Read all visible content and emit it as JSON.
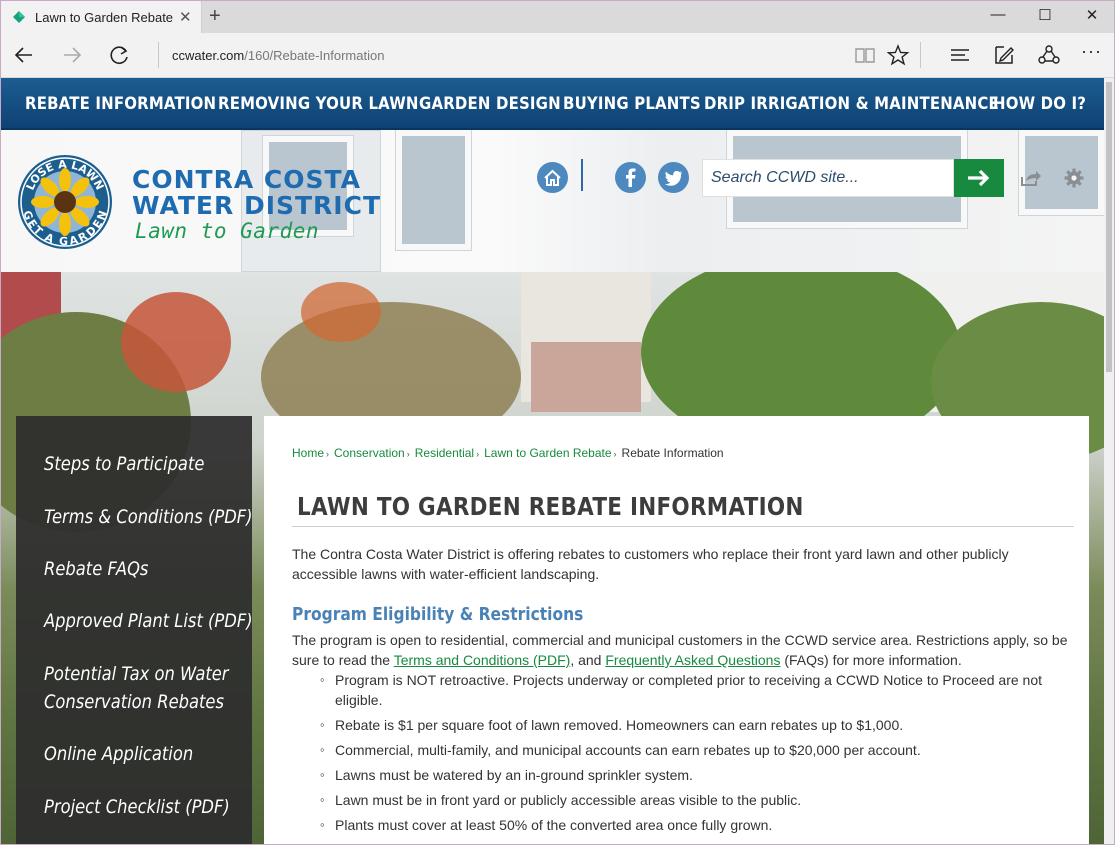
{
  "browser": {
    "tab_title": "Lawn to Garden Rebate",
    "close_tab_glyph": "✕",
    "new_tab_glyph": "+",
    "url_host": "ccwater.com",
    "url_path": "/160/Rebate-Information",
    "window_controls": {
      "minimize": "—",
      "maximize": "☐",
      "close": "✕"
    },
    "more_glyph": "···"
  },
  "topnav": {
    "items": [
      "REBATE INFORMATION",
      "REMOVING YOUR LAWN",
      "GARDEN DESIGN",
      "BUYING PLANTS",
      "DRIP IRRIGATION & MAINTENANCE",
      "HOW DO I?"
    ]
  },
  "header": {
    "org_line1": "CONTRA COSTA",
    "org_line2": "WATER DISTRICT",
    "tagline": "Lawn to Garden",
    "logo_text_top": "LOSE A LAWN",
    "logo_text_bottom": "GET A GARDEN",
    "search_placeholder": "Search CCWD site..."
  },
  "sidebar": {
    "items": [
      "Steps to Participate",
      "Terms & Conditions (PDF)",
      "Rebate FAQs",
      "Approved Plant List (PDF)",
      "Potential Tax on Water",
      "Conservation Rebates",
      "Online Application",
      "Project Checklist (PDF)"
    ]
  },
  "breadcrumb": {
    "items": [
      "Home",
      "Conservation",
      "Residential",
      "Lawn to Garden Rebate"
    ],
    "current": "Rebate Information"
  },
  "content": {
    "title": "LAWN TO GARDEN REBATE INFORMATION",
    "intro": "The Contra Costa Water District is offering rebates to customers who replace their front yard lawn and other publicly accessible lawns with water-efficient landscaping.",
    "section_heading": "Program Eligibility & Restrictions",
    "eligibility_text_1": "The program is open to residential, commercial and municipal customers in the CCWD service area. Restrictions apply, so be sure to read the ",
    "eligibility_link_1": "Terms and Conditions (PDF)",
    "eligibility_text_2": ", and ",
    "eligibility_link_2": "Frequently Asked Questions",
    "eligibility_text_3": " (FAQs) for more information.",
    "bullets": [
      "Program is NOT retroactive. Projects underway or completed prior to receiving a CCWD Notice to Proceed are not eligible.",
      "Rebate is $1 per square foot of lawn removed. Homeowners can earn rebates up to $1,000.",
      "Commercial, multi-family, and municipal accounts can earn rebates up to $20,000 per account.",
      "Lawns must be watered by an in-ground sprinkler system.",
      "Lawn must be in front yard or publicly accessible areas visible to the public.",
      "Plants must cover at least 50% of the converted area once fully grown."
    ]
  },
  "colors": {
    "nav_blue": "#0e4274",
    "brand_blue": "#1e6bb0",
    "brand_green": "#178a3f",
    "sidebar_bg": "#2d2d2d"
  },
  "icons": {
    "home": "home-icon",
    "facebook": "facebook-icon",
    "twitter": "twitter-icon",
    "search_go": "arrow-right-icon",
    "share": "share-icon",
    "settings": "gear-icon"
  }
}
